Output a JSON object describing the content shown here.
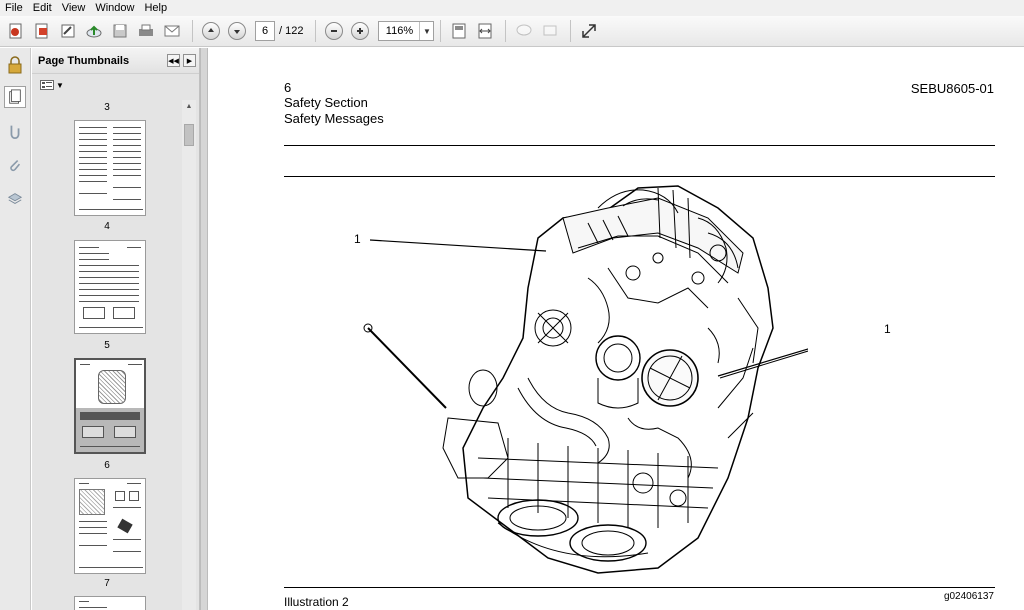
{
  "menu": [
    "File",
    "Edit",
    "View",
    "Window",
    "Help"
  ],
  "toolbar": {
    "page_current": "6",
    "page_total": "/ 122",
    "zoom": "116%",
    "icons": [
      "create-pdf-icon",
      "edit-pdf-icon",
      "sign-icon",
      "upload-icon",
      "save-icon",
      "print-icon",
      "email-icon",
      "prev-page-icon",
      "next-page-icon",
      "zoom-out-icon",
      "zoom-in-icon",
      "fit-page-icon",
      "fit-width-icon",
      "comment-icon",
      "highlight-icon",
      "fullscreen-icon"
    ]
  },
  "panel": {
    "title": "Page Thumbnails",
    "thumbnails": [
      {
        "label": "3"
      },
      {
        "label": "4"
      },
      {
        "label": "5"
      },
      {
        "label": "6",
        "selected": true
      },
      {
        "label": "7"
      }
    ]
  },
  "document": {
    "page_number": "6",
    "section": "Safety Section",
    "subsection": "Safety Messages",
    "doc_code": "SEBU8605-01",
    "callout_left": "1",
    "callout_right": "1",
    "caption": "Illustration 2",
    "figure_code": "g02406137"
  }
}
